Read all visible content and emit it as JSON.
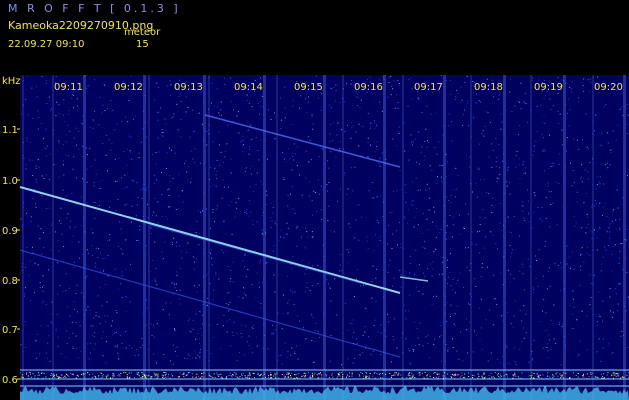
{
  "header": {
    "app_title": "M R O F F T  [ 0.1.3 ]",
    "file_name": "Kameoka2209270910.png",
    "mode_label": "meteor",
    "timestamp": "22.09.27 09:10",
    "count": "15"
  },
  "spectrogram": {
    "y_unit": "kHz",
    "y_ticks": [
      "1.1",
      "1.0",
      "0.9",
      "0.8",
      "0.7",
      "0.6"
    ],
    "time_ticks": [
      "09:11",
      "09:12",
      "09:13",
      "09:14",
      "09:15",
      "09:16",
      "09:17",
      "09:18",
      "09:19",
      "09:20"
    ],
    "colors": {
      "background": "#000060",
      "trace": "#9fe8ff",
      "label": "#f0e44a",
      "baseline": "#7fd0ff"
    }
  }
}
